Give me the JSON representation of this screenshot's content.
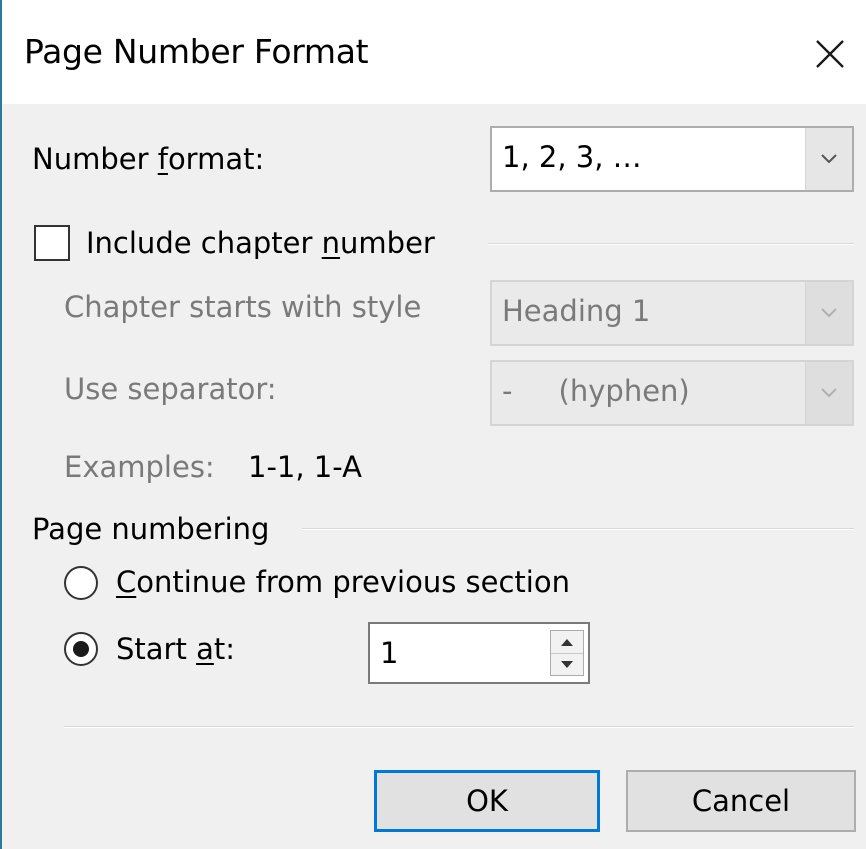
{
  "dialog": {
    "title": "Page Number Format"
  },
  "number_format": {
    "label_pre": "Number ",
    "label_key": "f",
    "label_post": "ormat:",
    "value": "1, 2, 3, …"
  },
  "chapter": {
    "include_label_pre": "Include chapter ",
    "include_label_key": "n",
    "include_label_post": "umber",
    "include_checked": false,
    "style_label": "Chapter starts with style",
    "style_value": "Heading 1",
    "separator_label": "Use separator:",
    "separator_value": "-     (hyphen)",
    "examples_label": "Examples:",
    "examples_value": "1-1, 1-A"
  },
  "page_numbering": {
    "group_label": "Page numbering",
    "continue_key": "C",
    "continue_post": "ontinue from previous section",
    "continue_selected": false,
    "start_pre": "Start ",
    "start_key": "a",
    "start_post": "t:",
    "start_selected": true,
    "start_value": "1"
  },
  "buttons": {
    "ok_label": "OK",
    "cancel_label": "Cancel"
  },
  "colors": {
    "accent": "#0078d7",
    "window_border": "#2b7a9c",
    "disabled_text": "#7a7a7a"
  }
}
